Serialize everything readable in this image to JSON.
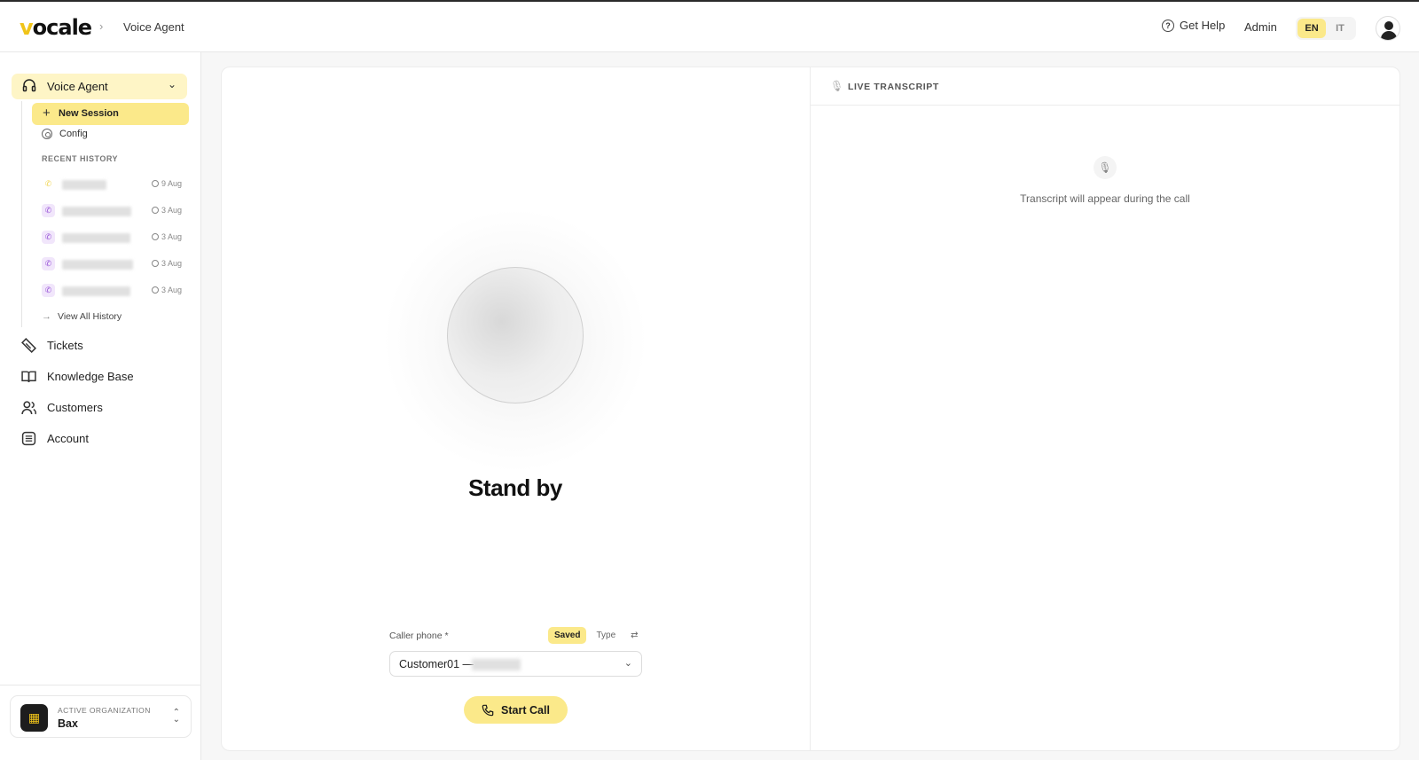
{
  "header": {
    "logo_prefix": "v",
    "logo_rest": "ocale",
    "breadcrumb_sep": "›",
    "breadcrumb": "Voice Agent",
    "help_label": "Get Help",
    "admin_label": "Admin",
    "lang_en": "EN",
    "lang_it": "IT"
  },
  "sidebar": {
    "voice_agent": "Voice Agent",
    "new_session": "New Session",
    "config": "Config",
    "recent_history_title": "RECENT HISTORY",
    "history": [
      {
        "date": "9 Aug",
        "type": "outgoing"
      },
      {
        "date": "3 Aug",
        "type": "incoming"
      },
      {
        "date": "3 Aug",
        "type": "incoming"
      },
      {
        "date": "3 Aug",
        "type": "incoming"
      },
      {
        "date": "3 Aug",
        "type": "incoming"
      }
    ],
    "view_all": "View All History",
    "nav": {
      "tickets": "Tickets",
      "knowledge_base": "Knowledge Base",
      "customers": "Customers",
      "account": "Account"
    },
    "org": {
      "sub": "ACTIVE ORGANIZATION",
      "name": "Bax"
    }
  },
  "call": {
    "status": "Stand by",
    "caller_label": "Caller phone *",
    "toggle_saved": "Saved",
    "toggle_type": "Type",
    "selected_value": "Customer01 —",
    "start_call": "Start Call"
  },
  "transcript": {
    "title": "LIVE TRANSCRIPT",
    "empty_text": "Transcript will appear during the call"
  },
  "colors": {
    "accent": "#fbe98a",
    "accent_soft": "#fef5c6",
    "incoming_purple": "#9b59d9"
  }
}
